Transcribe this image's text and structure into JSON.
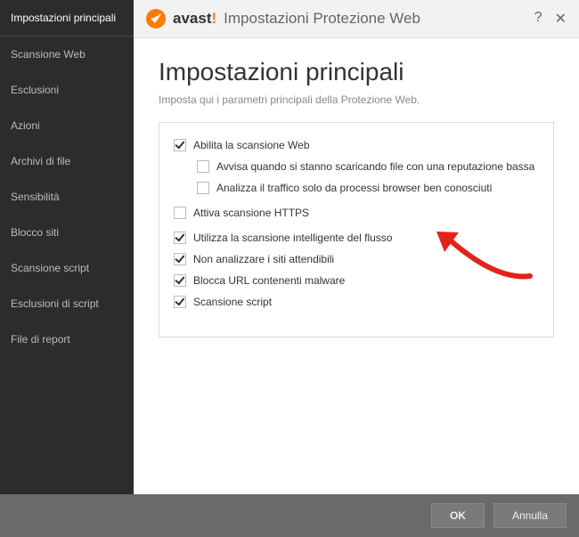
{
  "brand": {
    "part1": "avast",
    "part2": "!"
  },
  "header": {
    "title": "Impostazioni Protezione Web",
    "help": "?",
    "close": "✕"
  },
  "sidebar": {
    "items": [
      {
        "label": "Impostazioni principali",
        "active": true
      },
      {
        "label": "Scansione Web"
      },
      {
        "label": "Esclusioni"
      },
      {
        "label": "Azioni"
      },
      {
        "label": "Archivi di file"
      },
      {
        "label": "Sensibilità"
      },
      {
        "label": "Blocco siti"
      },
      {
        "label": "Scansione script"
      },
      {
        "label": "Esclusioni di script"
      },
      {
        "label": "File di report"
      }
    ]
  },
  "page": {
    "title": "Impostazioni principali",
    "subtitle": "Imposta qui i parametri principali della Protezione Web."
  },
  "options": [
    {
      "label": "Abilita la scansione Web",
      "checked": true,
      "indent": false
    },
    {
      "label": "Avvisa quando si stanno scaricando file con una reputazione bassa",
      "checked": false,
      "indent": true
    },
    {
      "label": "Analizza il traffico solo da processi browser ben conosciuti",
      "checked": false,
      "indent": true
    },
    {
      "label": "Attiva scansione HTTPS",
      "checked": false,
      "indent": false,
      "gap": true
    },
    {
      "label": "Utilizza la scansione intelligente del flusso",
      "checked": true,
      "indent": false,
      "gap": true
    },
    {
      "label": "Non analizzare i siti attendibili",
      "checked": true,
      "indent": false
    },
    {
      "label": "Blocca URL contenenti malware",
      "checked": true,
      "indent": false
    },
    {
      "label": "Scansione script",
      "checked": true,
      "indent": false
    }
  ],
  "footer": {
    "ok": "OK",
    "cancel": "Annulla"
  }
}
